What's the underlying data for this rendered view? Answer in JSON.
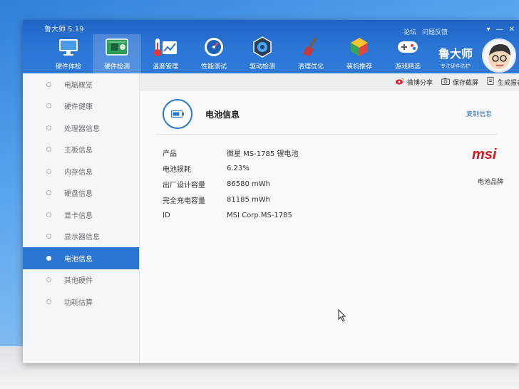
{
  "app": {
    "title": "鲁大师 5.19"
  },
  "toolbar": {
    "tools": [
      {
        "label": "硬件体检",
        "icon": "monitor-icon"
      },
      {
        "label": "硬件检测",
        "icon": "circuit-board-icon"
      },
      {
        "label": "温度管理",
        "icon": "thermometer-icon"
      },
      {
        "label": "性能测试",
        "icon": "gauge-icon"
      },
      {
        "label": "驱动检测",
        "icon": "gear-icon"
      },
      {
        "label": "清理优化",
        "icon": "broom-icon"
      },
      {
        "label": "装机推荐",
        "icon": "cube-icon"
      },
      {
        "label": "游戏精选",
        "icon": "gamepad-icon"
      }
    ],
    "top_links": [
      "论坛",
      "问题反馈"
    ]
  },
  "brand": {
    "name": "鲁大师",
    "slogan": "专注硬件防护"
  },
  "sidebar": {
    "items": [
      {
        "label": "电脑概览"
      },
      {
        "label": "硬件健康"
      },
      {
        "label": "处理器信息"
      },
      {
        "label": "主板信息"
      },
      {
        "label": "内存信息"
      },
      {
        "label": "硬盘信息"
      },
      {
        "label": "显卡信息"
      },
      {
        "label": "显示器信息"
      },
      {
        "label": "电池信息"
      },
      {
        "label": "其他硬件"
      },
      {
        "label": "功耗估算"
      }
    ],
    "active_index": 8
  },
  "actionbar": {
    "share": "微博分享",
    "save": "保存截屏",
    "report": "生成报表"
  },
  "section": {
    "title": "电池信息",
    "copy": "复制信息"
  },
  "battery": {
    "rows": [
      {
        "key": "产品",
        "value": "微星 MS-1785 锂电池"
      },
      {
        "key": "电池损耗",
        "value": "6.23%"
      },
      {
        "key": "出厂设计容量",
        "value": "86580 mWh"
      },
      {
        "key": "完全充电容量",
        "value": "81185 mWh"
      },
      {
        "key": "ID",
        "value": "MSI Corp.MS-1785"
      }
    ],
    "brand_logo_text": "msi",
    "brand_label": "电池品牌"
  },
  "colors": {
    "header": "#2b75d4",
    "accent": "#2a76d2",
    "msi_red": "#d4171f"
  }
}
